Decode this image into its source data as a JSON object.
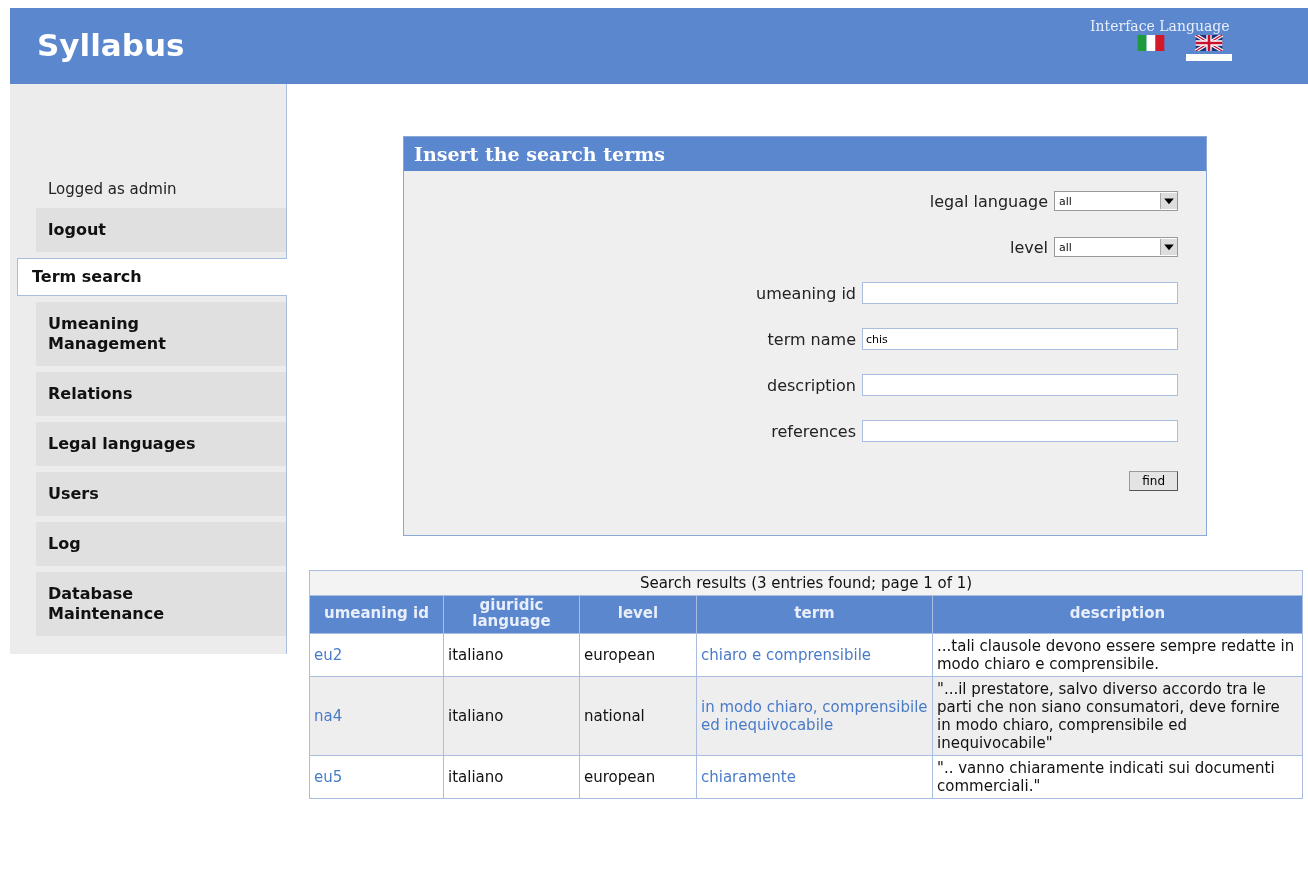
{
  "header": {
    "title": "Syllabus",
    "interface_language_label": "Interface Language",
    "languages": [
      {
        "kind": "italian",
        "selected": false
      },
      {
        "kind": "english",
        "selected": true
      }
    ]
  },
  "sidebar": {
    "logged_as": "Logged as admin",
    "items": [
      {
        "label": "logout",
        "selected": false
      },
      {
        "label": "Term search",
        "selected": true
      },
      {
        "label": "Umeaning Management",
        "selected": false
      },
      {
        "label": "Relations",
        "selected": false
      },
      {
        "label": "Legal languages",
        "selected": false
      },
      {
        "label": "Users",
        "selected": false
      },
      {
        "label": "Log",
        "selected": false
      },
      {
        "label": "Database Maintenance",
        "selected": false
      }
    ]
  },
  "search_form": {
    "title": "Insert the search terms",
    "fields": [
      {
        "kind": "select",
        "label": "legal language",
        "value": "all"
      },
      {
        "kind": "select",
        "label": "level",
        "value": "all"
      },
      {
        "kind": "text",
        "label": "umeaning id"
      },
      {
        "kind": "text",
        "label": "term name",
        "value": "chis"
      },
      {
        "kind": "text",
        "label": "description"
      },
      {
        "kind": "text",
        "label": "references"
      }
    ],
    "button": "find"
  },
  "results": {
    "caption": "Search results (3 entries found; page 1 of 1)",
    "columns": [
      "umeaning id",
      "giuridic language",
      "level",
      "term",
      "description"
    ],
    "rows": [
      [
        "eu2",
        "italiano",
        "european",
        "chiaro e comprensibile",
        "...tali clausole devono essere sempre redatte in modo chiaro e comprensibile."
      ],
      [
        "na4",
        "italiano",
        "national",
        "in modo chiaro, comprensibile ed inequivocabile",
        "\"...il prestatore, salvo diverso accordo tra le parti che non siano consumatori, deve fornire in modo chiaro, comprensibile ed inequivocabile\""
      ],
      [
        "eu5",
        "italiano",
        "european",
        "chiaramente",
        "\".. vanno chiaramente indicati sui documenti commerciali.\""
      ]
    ]
  }
}
